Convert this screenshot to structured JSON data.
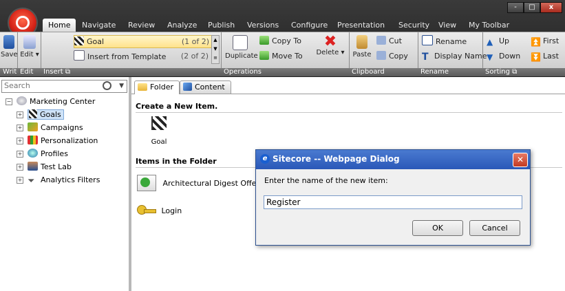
{
  "window": {
    "controls": [
      "-",
      "□",
      "x"
    ]
  },
  "ribbon_tabs": [
    "Home",
    "Navigate",
    "Review",
    "Analyze",
    "Publish",
    "Versions",
    "Configure",
    "Presentation",
    "Security",
    "View",
    "My Toolbar"
  ],
  "write_group": {
    "label": "Write",
    "save": "Save"
  },
  "edit_group": {
    "label": "Edit",
    "edit": "Edit"
  },
  "insert_group": {
    "label": "Insert",
    "items": [
      {
        "label": "Goal",
        "count": "(1 of 2)"
      },
      {
        "label": "Insert from Template",
        "count": "(2 of 2)"
      }
    ]
  },
  "operations_group": {
    "label": "Operations",
    "duplicate": "Duplicate",
    "copy_to": "Copy To",
    "move_to": "Move To",
    "delete": "Delete"
  },
  "clipboard_group": {
    "label": "Clipboard",
    "paste": "Paste",
    "cut": "Cut",
    "copy": "Copy"
  },
  "rename_group": {
    "label": "Rename",
    "rename": "Rename",
    "display_name": "Display Name"
  },
  "sorting_group": {
    "label": "Sorting",
    "up": "Up",
    "down": "Down",
    "first": "First",
    "last": "Last"
  },
  "search": {
    "placeholder": "Search"
  },
  "tree": {
    "root": "Marketing Center",
    "children": [
      "Goals",
      "Campaigns",
      "Personalization",
      "Profiles",
      "Test Lab",
      "Analytics Filters"
    ]
  },
  "content_tabs": [
    "Folder",
    "Content"
  ],
  "create_section": {
    "title": "Create a New Item.",
    "item": "Goal"
  },
  "folder_section": {
    "title": "Items in the Folder",
    "items": [
      "Architectural Digest Offer",
      "Login"
    ]
  },
  "dialog": {
    "title": "Sitecore -- Webpage Dialog",
    "prompt": "Enter the name of the new item:",
    "value": "Register",
    "ok": "OK",
    "cancel": "Cancel"
  }
}
